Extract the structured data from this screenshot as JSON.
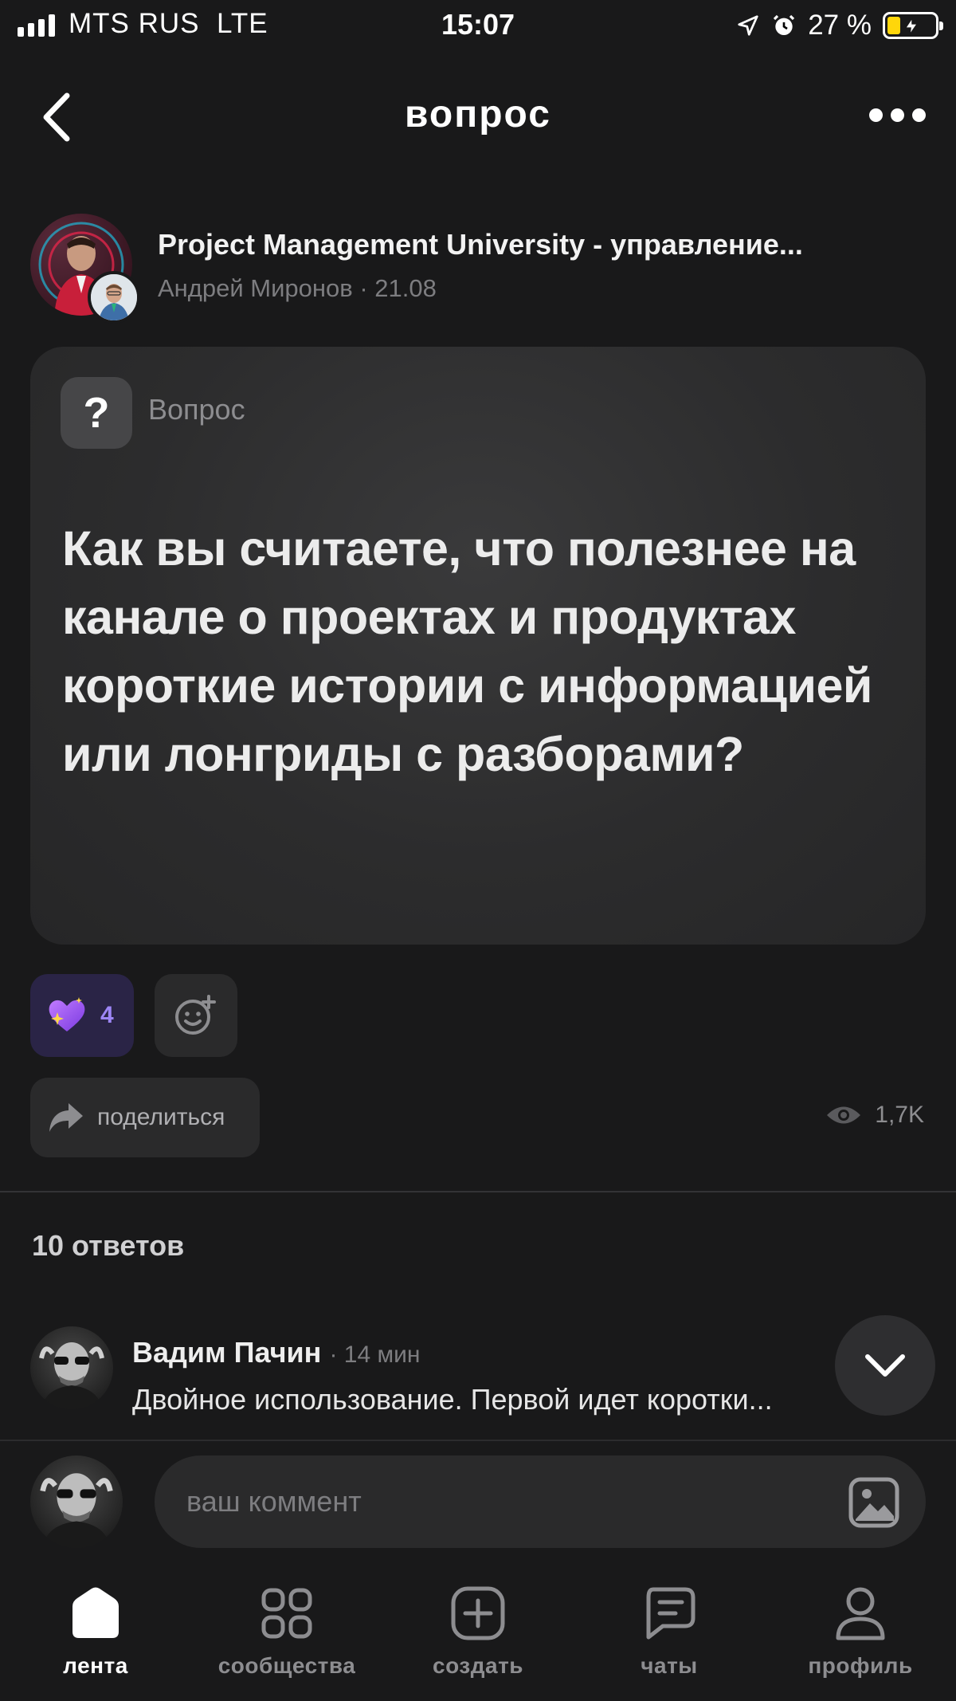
{
  "status_bar": {
    "carrier": "MTS RUS",
    "network": "LTE",
    "time": "15:07",
    "battery": "27 %"
  },
  "nav": {
    "title": "вопрос"
  },
  "post": {
    "community": "Project Management University - управление...",
    "author": "Андрей Миронов",
    "date": "21.08",
    "meta": "Андрей Миронов · 21.08"
  },
  "question": {
    "badge": "?",
    "label": "Вопрос",
    "text": "Как вы считаете, что полезнее на канале о проектах и продуктах короткие истории с информацией или лонгриды с разборами?"
  },
  "reactions": {
    "count": "4"
  },
  "actions": {
    "share_label": "поделиться",
    "views": "1,7K"
  },
  "answers": {
    "title": "10 ответов"
  },
  "comment": {
    "name": "Вадим Пачин",
    "time": "· 14 мин",
    "text": "Двойное использование. Первой идет коротки..."
  },
  "composer": {
    "placeholder": "ваш коммент"
  },
  "tabs": [
    {
      "label": "лента"
    },
    {
      "label": "сообщества"
    },
    {
      "label": "создать"
    },
    {
      "label": "чаты"
    },
    {
      "label": "профиль"
    }
  ],
  "colors": {
    "background": "#19191a",
    "card": "#2c2c2d",
    "reaction_bg": "#2a2446",
    "reaction_accent": "#9d86f5",
    "battery": "#ffd60a"
  }
}
